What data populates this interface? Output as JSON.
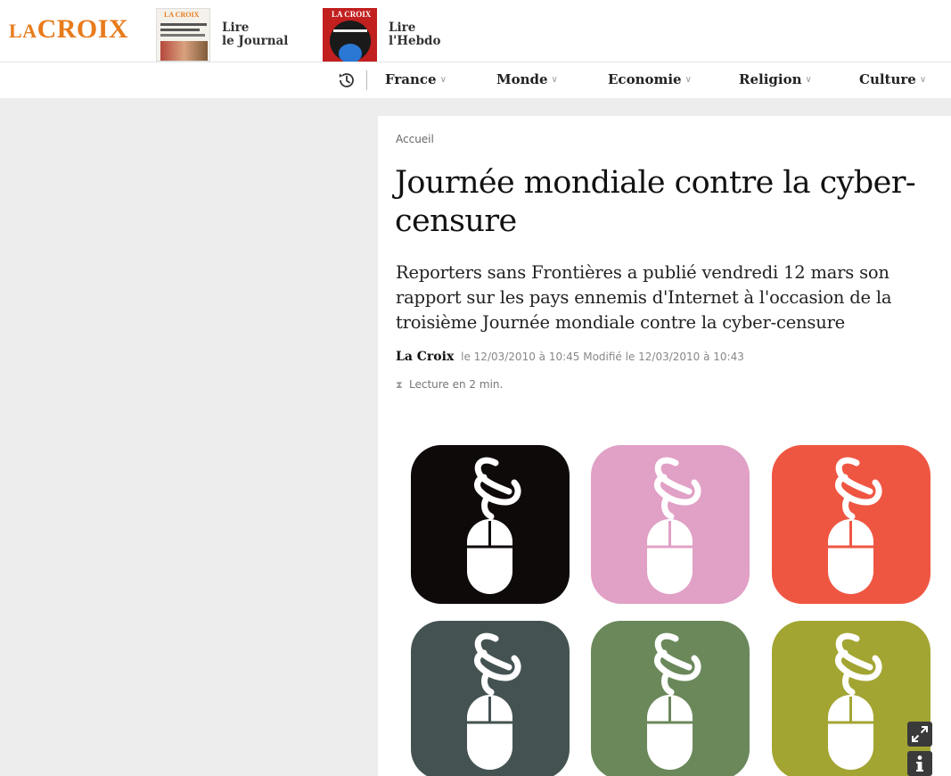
{
  "header": {
    "logo": {
      "la": "LA",
      "croix": "CROIX"
    },
    "publications": [
      {
        "line1": "Lire",
        "line2": "le Journal",
        "cover_masthead": "LA CROIX"
      },
      {
        "line1": "Lire",
        "line2": "l'Hebdo",
        "cover_masthead": "LA CROIX"
      }
    ]
  },
  "nav": {
    "history_icon": "clock-history-icon",
    "items": [
      {
        "label": "France",
        "chevron": "∨"
      },
      {
        "label": "Monde",
        "chevron": "∨"
      },
      {
        "label": "Economie",
        "chevron": "∨"
      },
      {
        "label": "Religion",
        "chevron": "∨"
      },
      {
        "label": "Culture",
        "chevron": "∨"
      }
    ]
  },
  "article": {
    "breadcrumb": "Accueil",
    "title": "Journée mondiale contre la cyber-censure",
    "lead": "Reporters sans Frontières a publié vendredi 12 mars son rapport sur les pays ennemis d'Internet à l'occasion de la troisième Journée mondiale contre la cyber-censure",
    "author": "La Croix",
    "dates": "le 12/03/2010 à 10:45 Modifié le 12/03/2010 à 10:43",
    "reading_icon": "hourglass-icon",
    "reading_time": "Lecture en 2 min."
  },
  "illustration": {
    "tile_colors": [
      "#0f0a0a",
      "#e1a0c5",
      "#ef5642",
      "#445352",
      "#6b885a",
      "#a3a533"
    ],
    "icon": "chain-mouse-icon",
    "controls": [
      "expand-icon",
      "info-icon"
    ]
  },
  "colors": {
    "brand": "#e87b1c",
    "background": "#ededed"
  }
}
